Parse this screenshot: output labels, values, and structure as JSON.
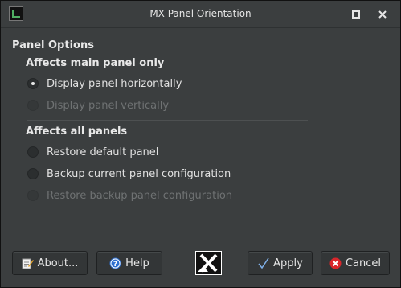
{
  "window": {
    "title": "MX Panel Orientation",
    "icons": {
      "app": "mx-panel-icon",
      "maximize": "maximize-icon",
      "close": "close-icon"
    }
  },
  "panel_options": {
    "heading": "Panel Options",
    "main_group": {
      "heading": "Affects main panel only",
      "options": [
        {
          "label": "Display panel horizontally",
          "checked": true,
          "enabled": true
        },
        {
          "label": "Display panel vertically",
          "checked": false,
          "enabled": false
        }
      ]
    },
    "all_group": {
      "heading": "Affects all panels",
      "options": [
        {
          "label": "Restore default panel",
          "checked": false,
          "enabled": true
        },
        {
          "label": "Backup current panel configuration",
          "checked": false,
          "enabled": true
        },
        {
          "label": "Restore backup panel configuration",
          "checked": false,
          "enabled": false
        }
      ]
    }
  },
  "buttons": {
    "about": {
      "label": "About...",
      "icon": "document-edit-icon"
    },
    "help": {
      "label": "Help",
      "icon": "help-icon"
    },
    "logo": {
      "icon": "mx-logo-icon"
    },
    "apply": {
      "label": "Apply",
      "icon": "checkmark-icon"
    },
    "cancel": {
      "label": "Cancel",
      "icon": "cancel-icon"
    }
  },
  "colors": {
    "background": "#3b3e3f",
    "text": "#e0e0e0",
    "disabled_text": "#6f7273",
    "help_icon": "#2d6fd0",
    "cancel_icon": "#d9262b",
    "apply_check": "#7fb0e8"
  }
}
